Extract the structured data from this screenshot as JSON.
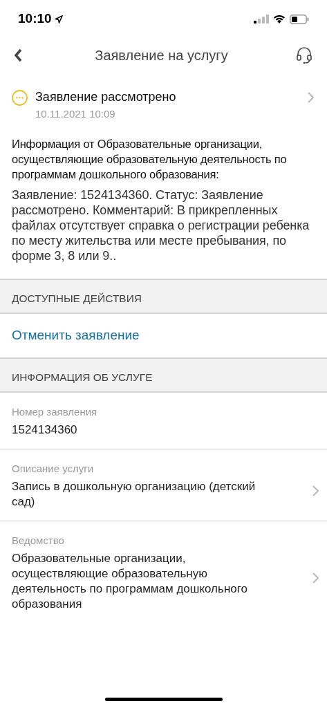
{
  "status_bar": {
    "time": "10:10"
  },
  "nav": {
    "title": "Заявление на услугу"
  },
  "status": {
    "label": "Заявление рассмотрено",
    "date": "10.11.2021 10:09"
  },
  "info": {
    "heading": "Информация от Образовательные организации, осуществляющие образовательную деятельность по программам дошкольного образования:",
    "body": "Заявление: 1524134360. Статус: Заявление рассмотрено. Комментарий: В прикрепленных файлах отсутствует справка о регистрации ребенка по месту жительства или месте пребывания, по форме 3, 8 или 9.."
  },
  "actions": {
    "header": "ДОСТУПНЫЕ ДЕЙСТВИЯ",
    "items": [
      "Отменить заявление"
    ]
  },
  "service_info": {
    "header": "ИНФОРМАЦИЯ ОБ УСЛУГЕ",
    "fields": [
      {
        "label": "Номер заявления",
        "value": "1524134360",
        "has_chevron": false
      },
      {
        "label": "Описание услуги",
        "value": "Запись в дошкольную организацию (детский сад)",
        "has_chevron": true
      },
      {
        "label": "Ведомство",
        "value": "Образовательные организации, осуществляющие образовательную деятельность по программам дошкольного образования",
        "has_chevron": true
      }
    ]
  }
}
